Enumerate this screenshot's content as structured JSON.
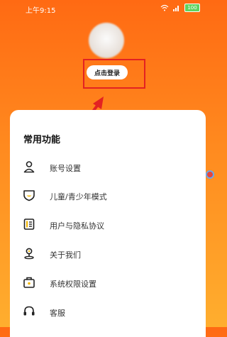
{
  "status_bar": {
    "time": "上午9:15",
    "battery": "100"
  },
  "header": {
    "login_label": "点击登录"
  },
  "section": {
    "title": "常用功能"
  },
  "menu": [
    {
      "label": "账号设置",
      "icon": "person-icon"
    },
    {
      "label": "儿童/青少年模式",
      "icon": "shield-icon"
    },
    {
      "label": "用户与隐私协议",
      "icon": "document-icon"
    },
    {
      "label": "关于我们",
      "icon": "location-pin-icon"
    },
    {
      "label": "系统权限设置",
      "icon": "briefcase-lock-icon"
    },
    {
      "label": "客服",
      "icon": "headset-icon"
    }
  ],
  "colors": {
    "accent": "#ff7a18",
    "highlight": "#e32222"
  }
}
